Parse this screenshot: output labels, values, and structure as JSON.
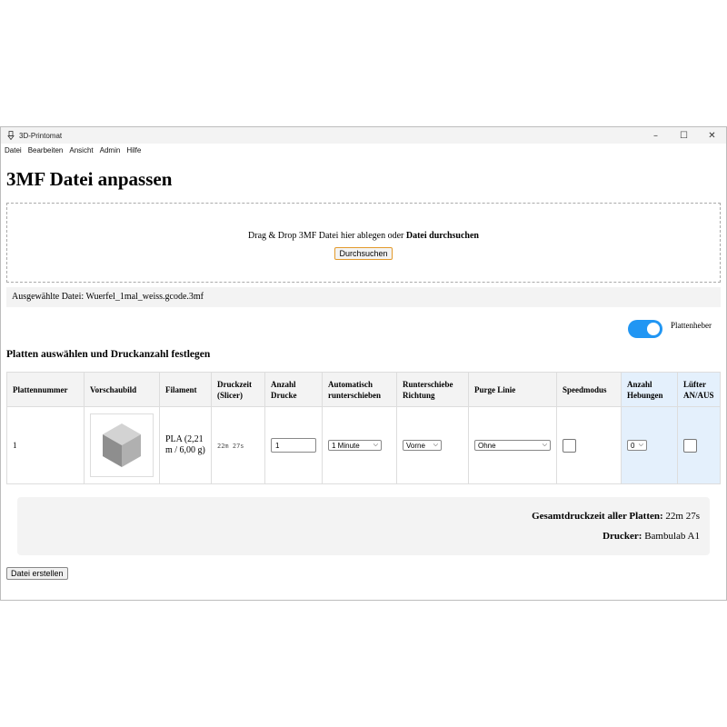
{
  "window": {
    "title": "3D-Printomat",
    "minimize": "–",
    "maximize": "☐",
    "close": "✕"
  },
  "menu": [
    "Datei",
    "Bearbeiten",
    "Ansicht",
    "Admin",
    "Hilfe"
  ],
  "page_title": "3MF Datei anpassen",
  "dropzone": {
    "text": "Drag & Drop 3MF Datei hier ablegen oder ",
    "link": "Datei durchsuchen",
    "button": "Durchsuchen"
  },
  "selected_file": "Ausgewählte Datei: Wuerfel_1mal_weiss.gcode.3mf",
  "toggle": {
    "label": "Plattenheber",
    "on": true,
    "color": "#2196f3"
  },
  "section_title": "Platten auswählen und Druckanzahl festlegen",
  "table": {
    "headers": [
      "Plattennummer",
      "Vorschaubild",
      "Filament",
      "Druckzeit (Slicer)",
      "Anzahl Drucke",
      "Automatisch runterschieben",
      "Runterschiebe Richtung",
      "Purge Linie",
      "Speedmodus",
      "Anzahl Hebungen",
      "Lüfter AN/AUS"
    ],
    "rows": [
      {
        "plate": "1",
        "preview": "cube-preview",
        "filament": "PLA (2,21 m / 6,00 g)",
        "time": "22m 27s",
        "qty": "1",
        "auto_push": "1 Minute",
        "direction": "Vorne",
        "purge": "Ohne",
        "speed": false,
        "lifts": "0",
        "fan": false
      }
    ]
  },
  "summary": {
    "total_label": "Gesamtdruckzeit aller Platten:",
    "total_value": "22m 27s",
    "printer_label": "Drucker:",
    "printer_value": "Bambulab A1"
  },
  "create_button": "Datei erstellen"
}
